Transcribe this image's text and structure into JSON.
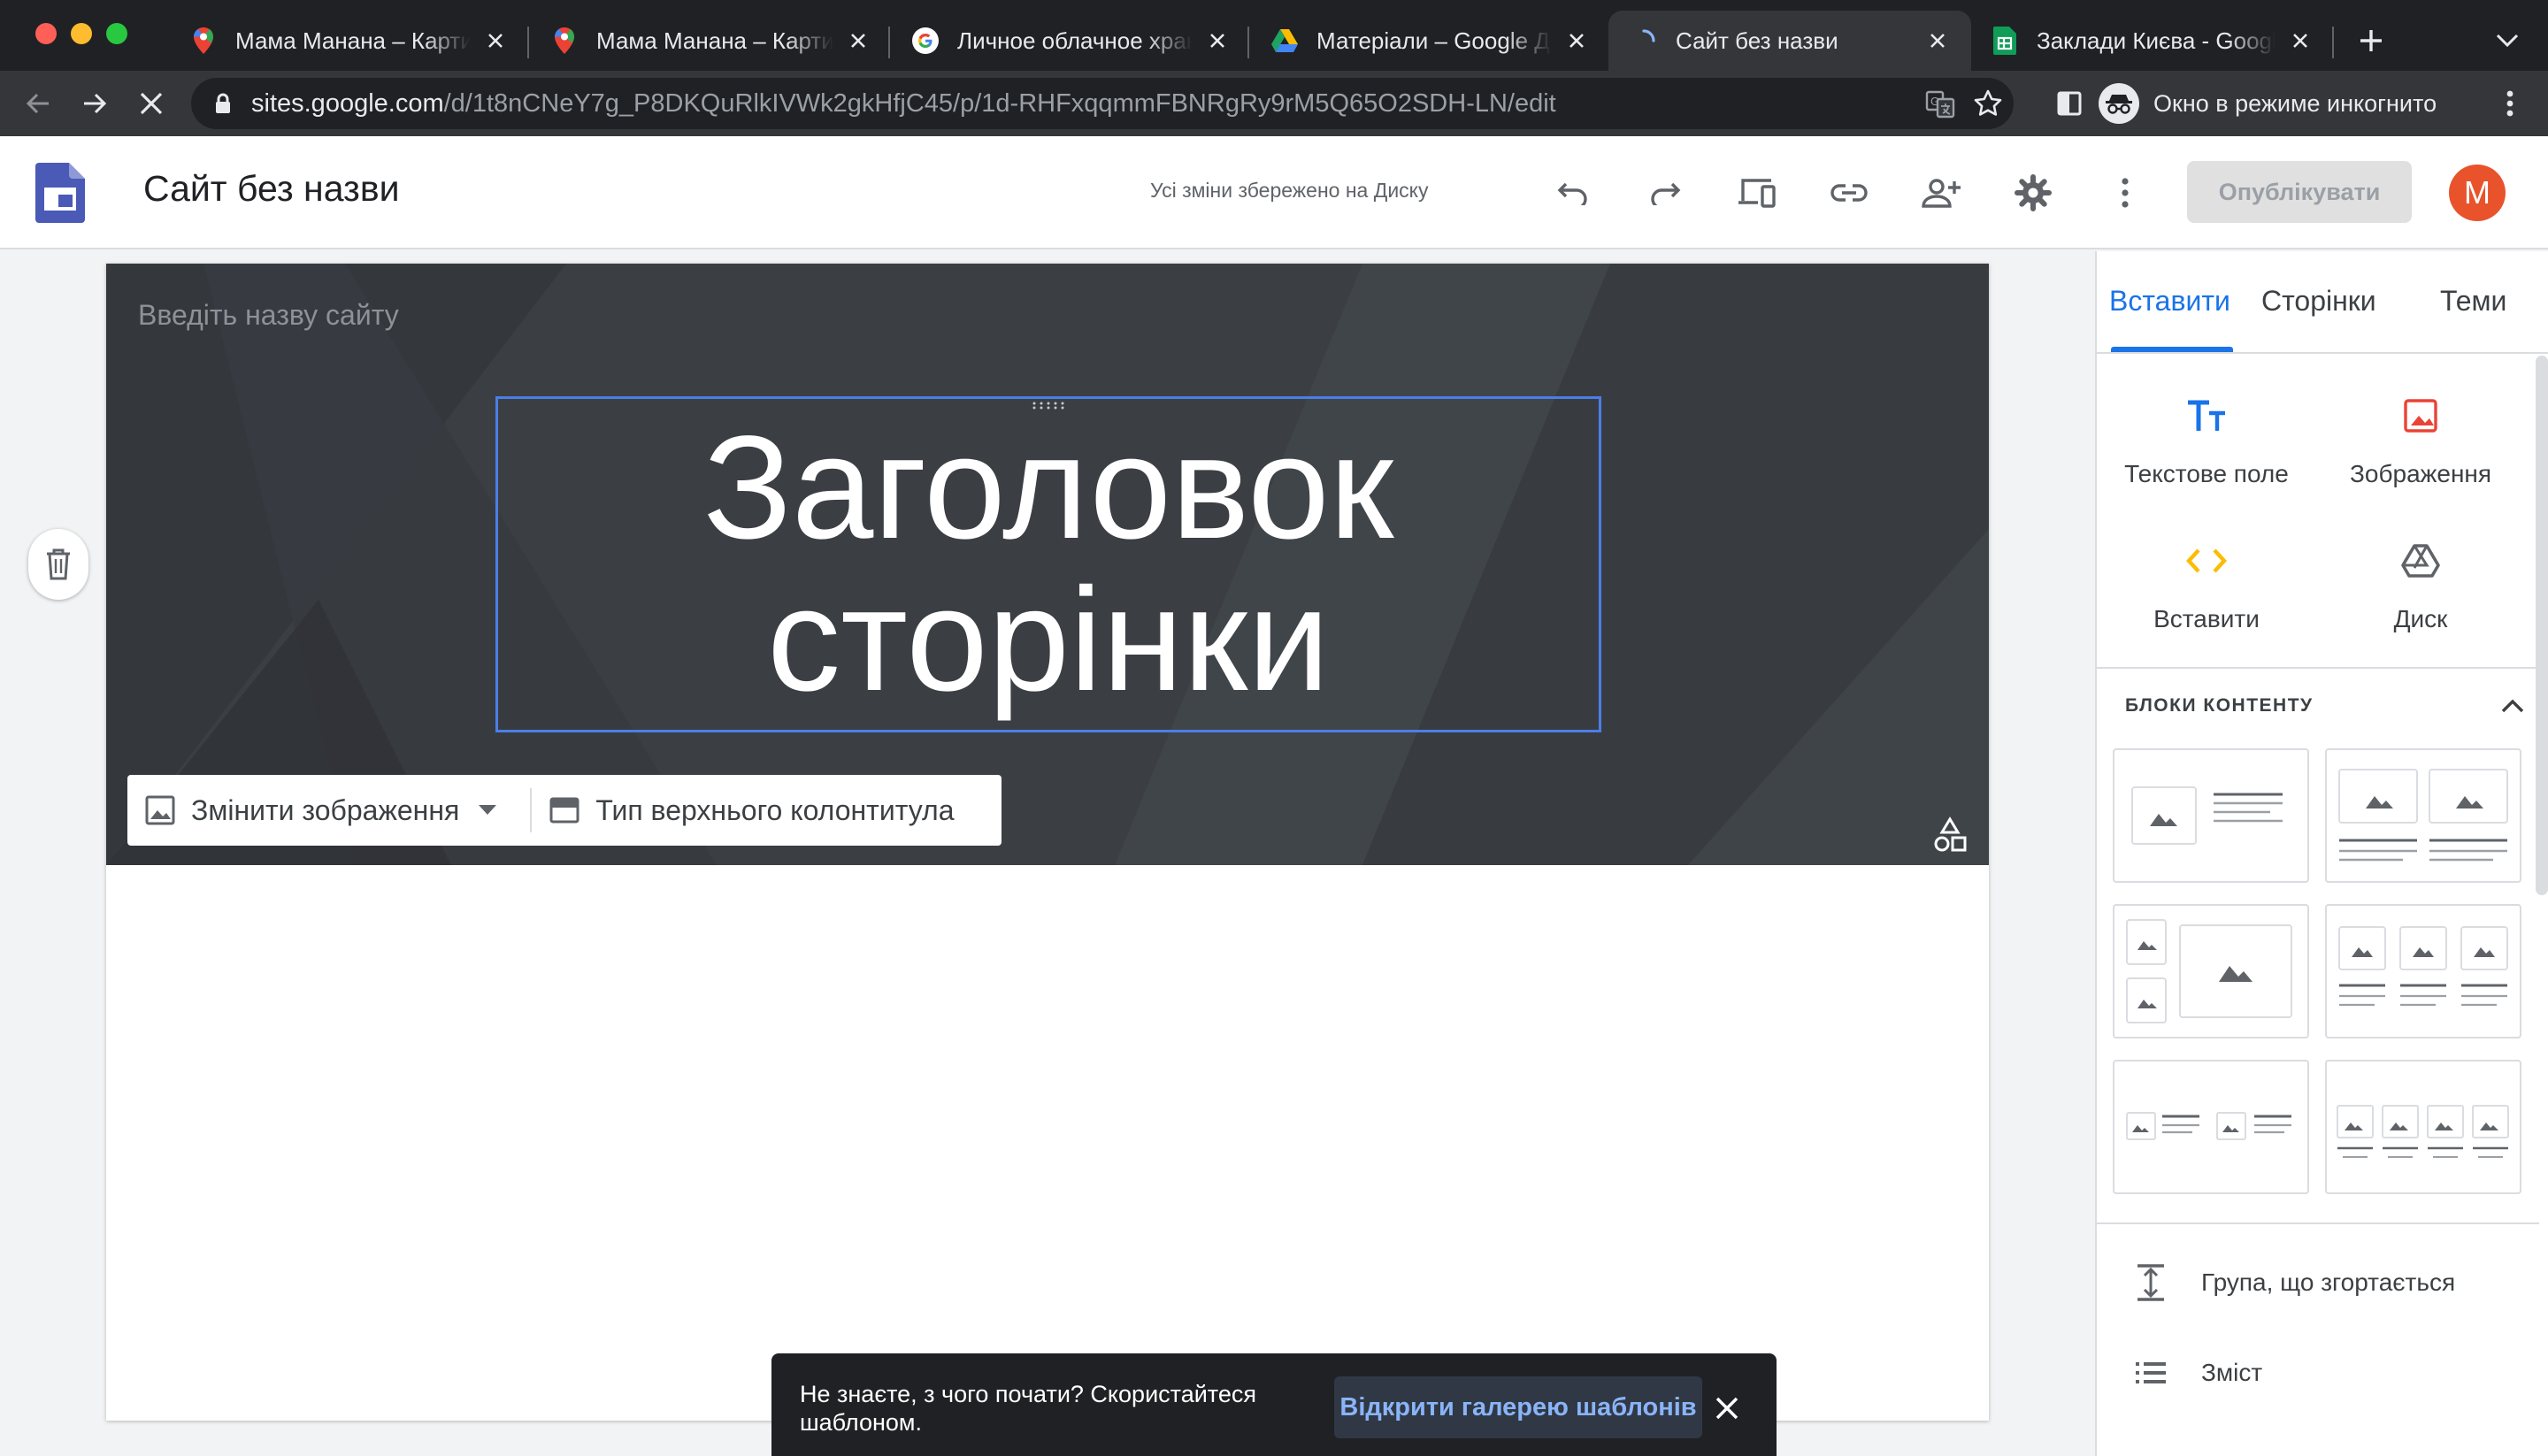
{
  "browser": {
    "tabs": [
      {
        "title": "Мама Манана – Карти Google",
        "icon": "google-maps-icon"
      },
      {
        "title": "Мама Манана – Карти Google",
        "icon": "google-maps-icon"
      },
      {
        "title": "Личное облачное хранилище",
        "icon": "google-g-icon"
      },
      {
        "title": "Матеріали – Google Диск",
        "icon": "google-drive-icon"
      },
      {
        "title": "Сайт без назви",
        "icon": "loading-spinner-icon",
        "active": true
      },
      {
        "title": "Заклади Києва - Google Таблиці",
        "icon": "google-sheets-icon"
      }
    ],
    "url_host": "sites.google.com",
    "url_path": "/d/1t8nCNeY7g_P8DKQuRlkIVWk2gkHfjC45/p/1d-RHFxqqmmFBNRgRy9rM5Q65O2SDH-LN/edit",
    "profile_label": "Окно в режиме инкогнито"
  },
  "app": {
    "title": "Сайт без назви",
    "save_status": "Усі зміни збережено на Диску",
    "publish_label": "Опублікувати",
    "avatar_letter": "M",
    "avatar_color": "#e8532c"
  },
  "banner": {
    "site_name_placeholder": "Введіть назву сайту",
    "page_title": "Заголовок сторінки",
    "change_image_label": "Змінити зображення",
    "header_type_label": "Тип верхнього колонтитула"
  },
  "snackbar": {
    "text": "Не знаєте, з чого почати? Скористайтеся шаблоном.",
    "link_label": "Відкрити галерею шаблонів"
  },
  "panel": {
    "tabs": [
      "Вставити",
      "Сторінки",
      "Теми"
    ],
    "active_tab": "Вставити",
    "insert_items": [
      "Текстове поле",
      "Зображення",
      "Вставити",
      "Диск"
    ],
    "content_blocks_title": "БЛОКИ КОНТЕНТУ",
    "collapsible_group": "Група, що згортається",
    "table_of_contents": "Зміст"
  },
  "colors": {
    "accent": "#1a73e8",
    "selection": "#4c7ee8",
    "banner_bg": "#3b3f44"
  }
}
